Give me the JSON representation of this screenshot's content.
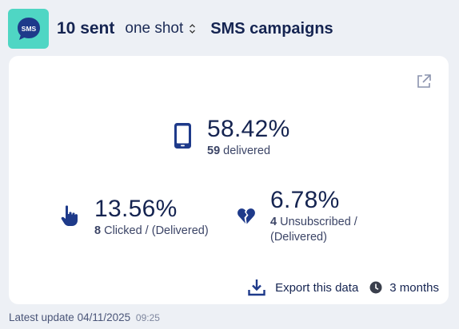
{
  "header": {
    "badge_text": "SMS",
    "sent_count": "10 sent",
    "mode": "one shot",
    "campaign_type": "SMS campaigns"
  },
  "stats": {
    "delivered": {
      "percent": "58.42%",
      "count": "59",
      "label": "delivered",
      "icon": "mobile-phone-icon"
    },
    "clicked": {
      "percent": "13.56%",
      "count": "8",
      "label": "Clicked / (Delivered)",
      "icon": "pointing-hand-icon"
    },
    "unsubscribed": {
      "percent": "6.78%",
      "count": "4",
      "label_line1": "Unsubscribed /",
      "label_line2": "(Delivered)",
      "icon": "broken-heart-icon"
    }
  },
  "actions": {
    "export_label": "Export this data",
    "period_label": "3 months"
  },
  "footer": {
    "last_update_label": "Latest update 04/11/2025",
    "last_update_time": "09:25"
  },
  "colors": {
    "badge_bg": "#4fd6c4",
    "primary_text": "#152451",
    "page_bg": "#edf0f5"
  }
}
